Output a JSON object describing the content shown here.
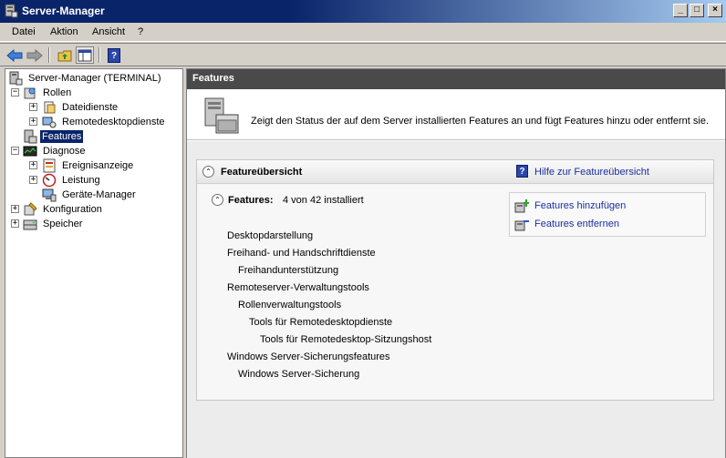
{
  "window": {
    "title": "Server-Manager",
    "controls": [
      "_",
      "□",
      "×"
    ]
  },
  "menu": {
    "items": [
      "Datei",
      "Aktion",
      "Ansicht",
      "?"
    ]
  },
  "toolbar": {
    "back": "back-arrow-icon",
    "forward": "forward-arrow-icon",
    "up": "up-folder-icon",
    "showhide": "show-hide-console-tree-icon",
    "help": "?"
  },
  "tree": {
    "root": "Server-Manager (TERMINAL)",
    "rollen": "Rollen",
    "dateidienste": "Dateidienste",
    "remotedesktop": "Remotedesktopdienste",
    "features": "Features",
    "diagnose": "Diagnose",
    "ereignisanzeige": "Ereignisanzeige",
    "leistung": "Leistung",
    "geraete": "Geräte-Manager",
    "konfiguration": "Konfiguration",
    "speicher": "Speicher",
    "expand_minus": "−",
    "expand_plus": "+"
  },
  "main": {
    "header": "Features",
    "description": "Zeigt den Status der auf dem Server installierten Features an und fügt Features hinzu oder entfernt sie.",
    "panel": {
      "title": "Featureübersicht",
      "help_icon": "?",
      "help_link": "Hilfe zur Featureübersicht",
      "collapse_glyph": "⌃",
      "features_label": "Features:",
      "features_count": "4 von 42 installiert",
      "items": [
        "Desktopdarstellung",
        "Freihand- und Handschriftdienste",
        "Freihandunterstützung",
        "Remoteserver-Verwaltungstools",
        "Rollenverwaltungstools",
        "Tools für Remotedesktopdienste",
        "Tools für Remotedesktop-Sitzungshost",
        "Windows Server-Sicherungsfeatures",
        "Windows Server-Sicherung"
      ],
      "actions": {
        "add": "Features hinzufügen",
        "remove": "Features entfernen"
      }
    }
  },
  "colors": {
    "link": "#1a2fa0",
    "selected": "#0a246a",
    "header_dark": "#4a4a4a",
    "titlebar": "#0a246a"
  }
}
